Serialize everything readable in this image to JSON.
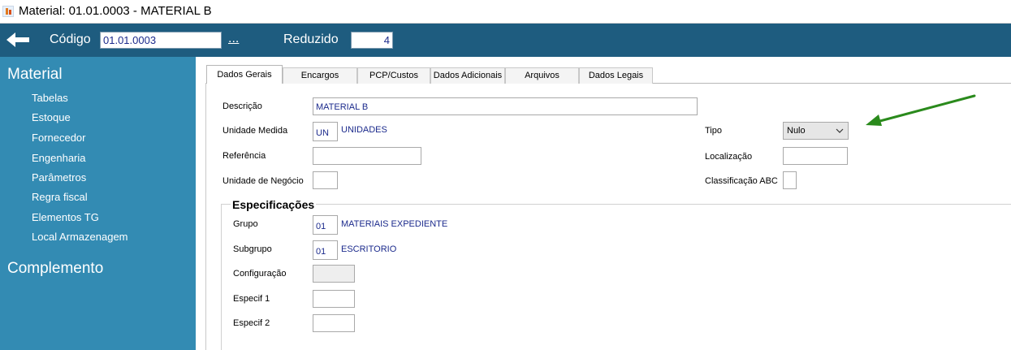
{
  "window": {
    "title": "Material: 01.01.0003 - MATERIAL B"
  },
  "topbar": {
    "codigo_label": "Código",
    "codigo_value": "01.01.0003",
    "more_label": "...",
    "reduzido_label": "Reduzido",
    "reduzido_value": "4"
  },
  "sidebar": {
    "section1": "Material",
    "items": [
      "Tabelas",
      "Estoque",
      "Fornecedor",
      "Engenharia",
      "Parâmetros",
      "Regra fiscal",
      "Elementos TG",
      "Local Armazenagem"
    ],
    "section2": "Complemento"
  },
  "tabs": [
    "Dados Gerais",
    "Encargos",
    "PCP/Custos",
    "Dados Adicionais",
    "Arquivos",
    "Dados Legais"
  ],
  "form": {
    "descricao_label": "Descrição",
    "descricao_value": "MATERIAL B",
    "unidade_label": "Unidade Medida",
    "unidade_value": "UN",
    "unidade_desc": "UNIDADES",
    "referencia_label": "Referência",
    "referencia_value": "",
    "negocio_label": "Unidade de Negócio",
    "negocio_value": "",
    "tipo_label": "Tipo",
    "tipo_value": "Nulo",
    "localizacao_label": "Localização",
    "localizacao_value": "",
    "abc_label": "Classificação ABC",
    "abc_value": ""
  },
  "especificacoes": {
    "legend": "Especificações",
    "grupo_label": "Grupo",
    "grupo_value": "01",
    "grupo_desc": "MATERIAIS EXPEDIENTE",
    "subgrupo_label": "Subgrupo",
    "subgrupo_value": "01",
    "subgrupo_desc": "ESCRITORIO",
    "configuracao_label": "Configuração",
    "configuracao_value": "",
    "especif1_label": "Especif 1",
    "especif1_value": "",
    "especif2_label": "Especif 2",
    "especif2_value": ""
  },
  "colors": {
    "topbar": "#1e5c7f",
    "sidebar": "#338bb3",
    "field_text": "#1b2a8c",
    "annotation": "#2a8a1c"
  },
  "icons": {
    "app": "app-icon",
    "back": "back-arrow-icon",
    "dropdown": "chevron-down-icon",
    "annotation": "green-arrow-annotation"
  }
}
